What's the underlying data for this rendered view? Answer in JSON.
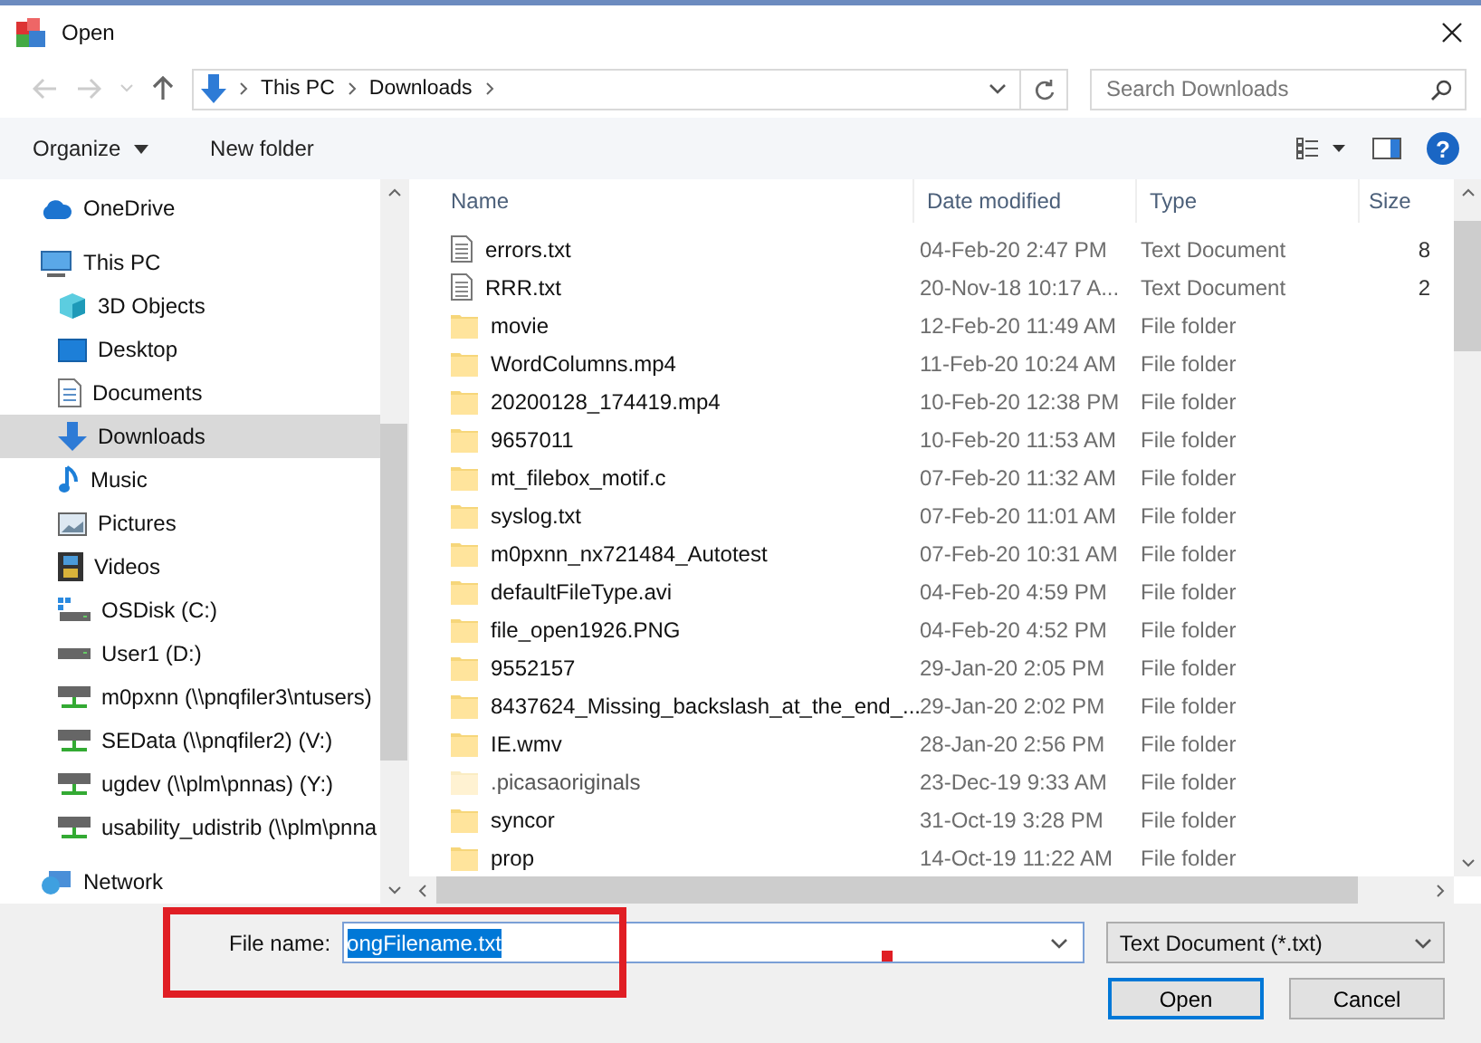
{
  "window": {
    "title": "Open"
  },
  "nav": {
    "path": [
      "This PC",
      "Downloads"
    ],
    "search": {
      "placeholder": "Search Downloads"
    }
  },
  "toolbar": {
    "organize": "Organize",
    "new_folder": "New folder",
    "help": "?"
  },
  "sidebar": {
    "items": [
      {
        "label": "OneDrive",
        "kind": "cloud",
        "selected": false
      },
      {
        "label": "This PC",
        "kind": "computer",
        "selected": false,
        "children": [
          {
            "label": "3D Objects",
            "kind": "cube",
            "selected": false
          },
          {
            "label": "Desktop",
            "kind": "desktop",
            "selected": false
          },
          {
            "label": "Documents",
            "kind": "document",
            "selected": false
          },
          {
            "label": "Downloads",
            "kind": "download",
            "selected": true
          },
          {
            "label": "Music",
            "kind": "music",
            "selected": false
          },
          {
            "label": "Pictures",
            "kind": "picture",
            "selected": false
          },
          {
            "label": "Videos",
            "kind": "video",
            "selected": false
          },
          {
            "label": "OSDisk (C:)",
            "kind": "osdisk",
            "selected": false
          },
          {
            "label": "User1 (D:)",
            "kind": "drive",
            "selected": false
          },
          {
            "label": "m0pxnn (\\\\pnqfiler3\\ntusers)",
            "kind": "netdrive",
            "selected": false
          },
          {
            "label": "SEData (\\\\pnqfiler2) (V:)",
            "kind": "netdrive",
            "selected": false
          },
          {
            "label": "ugdev (\\\\plm\\pnnas) (Y:)",
            "kind": "netdrive",
            "selected": false
          },
          {
            "label": "usability_udistrib (\\\\plm\\pnna",
            "kind": "netdrive",
            "selected": false
          }
        ]
      },
      {
        "label": "Network",
        "kind": "network",
        "selected": false
      }
    ]
  },
  "table": {
    "columns": [
      "Name",
      "Date modified",
      "Type",
      "Size"
    ],
    "rows": [
      {
        "name": "errors.txt",
        "date": "04-Feb-20 2:47 PM",
        "type": "Text Document",
        "size": "8",
        "kind": "text",
        "hidden": false
      },
      {
        "name": "RRR.txt",
        "date": "20-Nov-18 10:17 A...",
        "type": "Text Document",
        "size": "2",
        "kind": "text",
        "hidden": false
      },
      {
        "name": "movie",
        "date": "12-Feb-20 11:49 AM",
        "type": "File folder",
        "kind": "folder",
        "hidden": false
      },
      {
        "name": "WordColumns.mp4",
        "date": "11-Feb-20 10:24 AM",
        "type": "File folder",
        "kind": "folder",
        "hidden": false
      },
      {
        "name": "20200128_174419.mp4",
        "date": "10-Feb-20 12:38 PM",
        "type": "File folder",
        "kind": "folder",
        "hidden": false
      },
      {
        "name": "9657011",
        "date": "10-Feb-20 11:53 AM",
        "type": "File folder",
        "kind": "folder",
        "hidden": false
      },
      {
        "name": "mt_filebox_motif.c",
        "date": "07-Feb-20 11:32 AM",
        "type": "File folder",
        "kind": "folder",
        "hidden": false
      },
      {
        "name": "syslog.txt",
        "date": "07-Feb-20 11:01 AM",
        "type": "File folder",
        "kind": "folder",
        "hidden": false
      },
      {
        "name": "m0pxnn_nx721484_Autotest",
        "date": "07-Feb-20 10:31 AM",
        "type": "File folder",
        "kind": "folder",
        "hidden": false
      },
      {
        "name": "defaultFileType.avi",
        "date": "04-Feb-20 4:59 PM",
        "type": "File folder",
        "kind": "folder",
        "hidden": false
      },
      {
        "name": "file_open1926.PNG",
        "date": "04-Feb-20 4:52 PM",
        "type": "File folder",
        "kind": "folder",
        "hidden": false
      },
      {
        "name": "9552157",
        "date": "29-Jan-20 2:05 PM",
        "type": "File folder",
        "kind": "folder",
        "hidden": false
      },
      {
        "name": "8437624_Missing_backslash_at_the_end_...",
        "date": "29-Jan-20 2:02 PM",
        "type": "File folder",
        "kind": "folder",
        "hidden": false
      },
      {
        "name": "IE.wmv",
        "date": "28-Jan-20 2:56 PM",
        "type": "File folder",
        "kind": "folder",
        "hidden": false
      },
      {
        "name": ".picasaoriginals",
        "date": "23-Dec-19 9:33 AM",
        "type": "File folder",
        "kind": "folder",
        "hidden": true
      },
      {
        "name": "syncor",
        "date": "31-Oct-19 3:28 PM",
        "type": "File folder",
        "kind": "folder",
        "hidden": false
      },
      {
        "name": "prop",
        "date": "14-Oct-19 11:22 AM",
        "type": "File folder",
        "kind": "folder",
        "hidden": false
      }
    ]
  },
  "footer": {
    "file_name_label": "File name:",
    "file_name": {
      "value": "ongFilename.txt",
      "text_selected": true
    },
    "file_type": "Text Document (*.txt)",
    "buttons": [
      "Open",
      "Cancel"
    ]
  }
}
